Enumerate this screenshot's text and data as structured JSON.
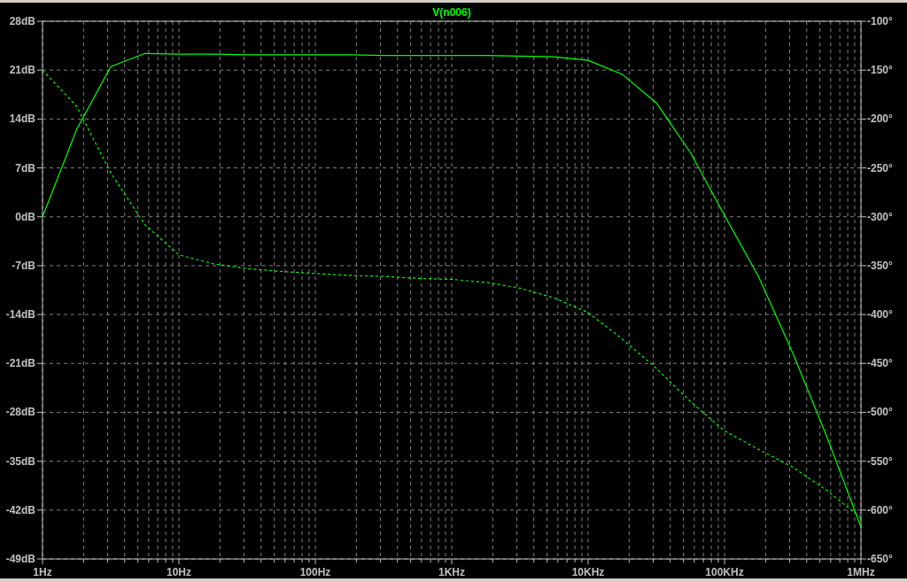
{
  "plot": {
    "chart_data": {
      "type": "line",
      "title": "V(n006)",
      "categories": [
        "1Hz",
        null,
        null,
        null,
        "10Hz",
        null,
        null,
        null,
        "100Hz",
        null,
        null,
        null,
        "1KHz",
        null,
        null,
        null,
        "10KHz",
        null,
        null,
        null,
        "100KHz",
        null,
        null,
        null,
        "1MHz"
      ],
      "grid": true,
      "ylim": [
        -49,
        28
      ],
      "yticks": [
        {
          "value": 28,
          "label": "28dB"
        },
        {
          "value": 21,
          "label": "21dB"
        },
        {
          "value": 14,
          "label": "14dB"
        },
        {
          "value": 7,
          "label": "7dB"
        },
        {
          "value": 0,
          "label": "0dB"
        },
        {
          "value": -7,
          "label": "-7dB"
        },
        {
          "value": -14,
          "label": "-14dB"
        },
        {
          "value": -21,
          "label": "-21dB"
        },
        {
          "value": -28,
          "label": "-28dB"
        },
        {
          "value": -35,
          "label": "-35dB"
        },
        {
          "value": -42,
          "label": "-42dB"
        },
        {
          "value": -49,
          "label": "-49dB"
        }
      ],
      "y2lim": [
        -650,
        -100
      ],
      "y2ticks": [
        {
          "value": -100,
          "label": "-100°"
        },
        {
          "value": -150,
          "label": "-150°"
        },
        {
          "value": -200,
          "label": "-200°"
        },
        {
          "value": -250,
          "label": "-250°"
        },
        {
          "value": -300,
          "label": "-300°"
        },
        {
          "value": -350,
          "label": "-350°"
        },
        {
          "value": -400,
          "label": "-400°"
        },
        {
          "value": -450,
          "label": "-450°"
        },
        {
          "value": -500,
          "label": "-500°"
        },
        {
          "value": -550,
          "label": "-550°"
        },
        {
          "value": -600,
          "label": "-600°"
        },
        {
          "value": -650,
          "label": "-650°"
        }
      ],
      "series": [
        {
          "color": "#00ff00",
          "line_style": "solid",
          "axis": "y",
          "values": [
            0,
            12.5,
            21.5,
            23.4,
            23.3,
            23.3,
            23.2,
            23.2,
            23.2,
            23.2,
            23.1,
            23.1,
            23.1,
            23.1,
            23,
            22.9,
            22.4,
            20.4,
            16.3,
            9.2,
            0.2,
            -8.6,
            -19.5,
            -31.5,
            -44.4
          ]
        },
        {
          "color": "#00ff00",
          "line_style": "dashed",
          "axis": "y2",
          "values": [
            -150,
            -187,
            -255,
            -308,
            -339,
            -348,
            -353,
            -356,
            -358,
            -360,
            -361,
            -363,
            -364,
            -367,
            -373,
            -383,
            -398,
            -425,
            -455,
            -489,
            -519,
            -538,
            -556,
            -580,
            -608
          ]
        }
      ]
    }
  }
}
